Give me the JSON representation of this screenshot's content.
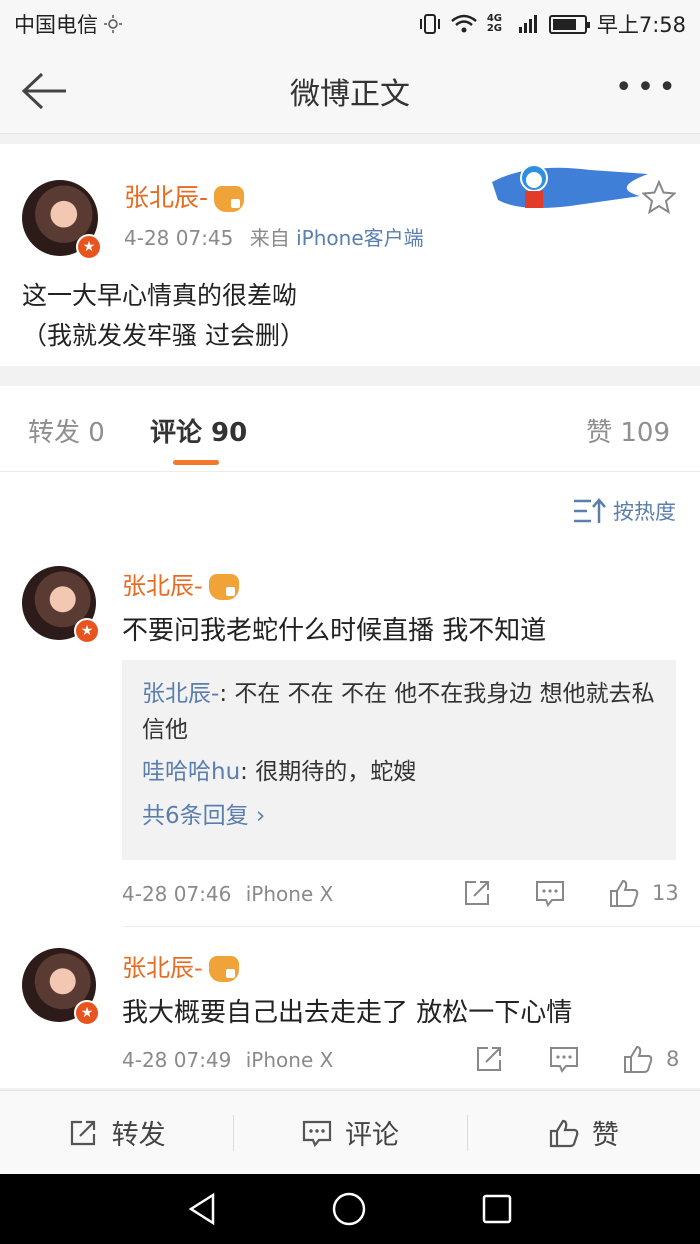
{
  "status_bar": {
    "carrier": "中国电信",
    "network": "4G 2G",
    "time": "早上7:58",
    "battery_level": 0.75
  },
  "nav": {
    "title": "微博正文",
    "more": "•••"
  },
  "post": {
    "username": "张北辰-",
    "time": "4-28 07:45",
    "source_prefix": "来自",
    "source": "iPhone客户端",
    "text": "这一大早心情真的很差呦\n（我就发发牢骚 过会删）"
  },
  "tabs": {
    "repost": "转发 0",
    "comment": "评论 90",
    "like": "赞 109"
  },
  "sort_label": "按热度",
  "comments": [
    {
      "username": "张北辰-",
      "text": "不要问我老蛇什么时候直播 我不知道",
      "replies": [
        {
          "name": "张北辰-",
          "text": ": 不在 不在 不在 他不在我身边   想他就去私信他"
        },
        {
          "name": "哇哈哈hu",
          "text": ": 很期待的，蛇嫂"
        }
      ],
      "more_replies": "共6条回复 ›",
      "time": "4-28 07:46",
      "device": "iPhone X",
      "likes": "13"
    },
    {
      "username": "张北辰-",
      "text": "我大概要自己出去走走了 放松一下心情",
      "time": "4-28 07:49",
      "device": "iPhone X",
      "likes": "8"
    }
  ],
  "bottom_bar": {
    "repost": "转发",
    "comment": "评论",
    "like": "赞"
  },
  "colors": {
    "accent": "#e86b22",
    "link": "#5a7fae",
    "indicator": "#f0792b"
  }
}
